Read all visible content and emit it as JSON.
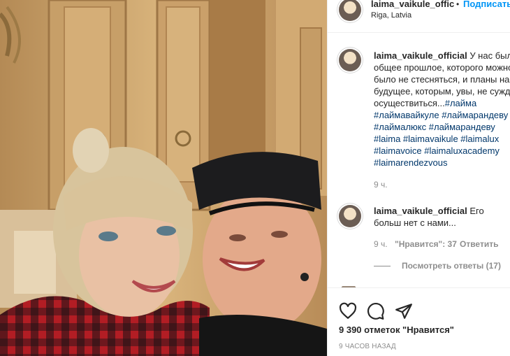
{
  "post": {
    "username": "laima_vaikule_offic",
    "separator": "•",
    "follow_label": "Подписаться",
    "location": "Riga, Latvia"
  },
  "caption": {
    "username": "laima_vaikule_official",
    "text": "У нас был общее прошлое, которого можно было не стесняться, и планы на будущее, которым, увы, не суждено осуществиться...",
    "hashtags": [
      "#лайма",
      "#лаймавайкуле #лаймарандеву",
      "#лаймалюкс #лаймарандеву",
      "#laima #laimavaikule #laimalux",
      "#laimavoice #laimaluxacademy",
      "#laimarendezvous"
    ],
    "time": "9 ч."
  },
  "comment": {
    "username": "laima_vaikule_official",
    "text": "Его больш нет с нами...",
    "time": "9 ч.",
    "likes_label": "\"Нравится\": 37",
    "reply_label": "Ответить",
    "view_replies": "Посмотреть ответы (17)"
  },
  "footer": {
    "likes": "9 390 отметок \"Нравится\"",
    "time_ago": "9 ЧАСОВ НАЗАД"
  },
  "icons": [
    "heart-icon",
    "comment-icon",
    "share-icon"
  ],
  "colors": {
    "link": "#0095f6",
    "hashtag": "#00376b",
    "muted": "#8e8e8e"
  }
}
